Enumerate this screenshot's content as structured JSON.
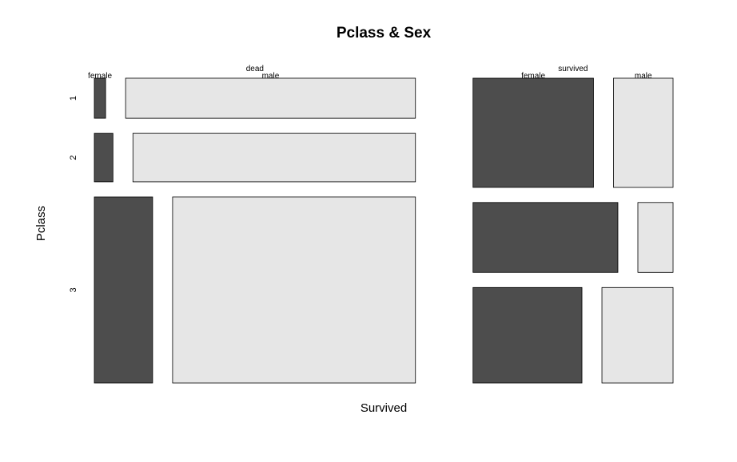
{
  "chart_data": {
    "type": "mosaic",
    "title": "Pclass & Sex",
    "xlabel": "Survived",
    "ylabel": "Pclass",
    "survived_levels": [
      "dead",
      "survived"
    ],
    "pclass_levels": [
      "1",
      "2",
      "3"
    ],
    "sex_levels": [
      "female",
      "male"
    ],
    "colors": {
      "female": "#4d4d4d",
      "male": "#e6e6e6"
    },
    "cells": [
      {
        "survived": "dead",
        "pclass": "1",
        "sex": "female",
        "count": 3
      },
      {
        "survived": "dead",
        "pclass": "1",
        "sex": "male",
        "count": 77
      },
      {
        "survived": "dead",
        "pclass": "2",
        "sex": "female",
        "count": 6
      },
      {
        "survived": "dead",
        "pclass": "2",
        "sex": "male",
        "count": 91
      },
      {
        "survived": "dead",
        "pclass": "3",
        "sex": "female",
        "count": 72
      },
      {
        "survived": "dead",
        "pclass": "3",
        "sex": "male",
        "count": 300
      },
      {
        "survived": "survived",
        "pclass": "1",
        "sex": "female",
        "count": 91
      },
      {
        "survived": "survived",
        "pclass": "1",
        "sex": "male",
        "count": 45
      },
      {
        "survived": "survived",
        "pclass": "2",
        "sex": "female",
        "count": 70
      },
      {
        "survived": "survived",
        "pclass": "2",
        "sex": "male",
        "count": 17
      },
      {
        "survived": "survived",
        "pclass": "3",
        "sex": "female",
        "count": 72
      },
      {
        "survived": "survived",
        "pclass": "3",
        "sex": "male",
        "count": 47
      }
    ]
  }
}
